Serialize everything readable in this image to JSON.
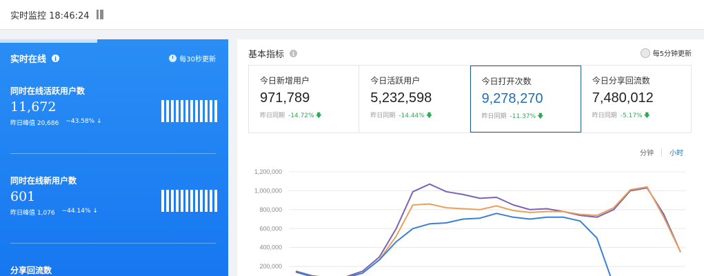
{
  "topbar": {
    "title": "实时监控 18:46:24",
    "icon": "document-icon"
  },
  "left": {
    "header": "实时在线",
    "refresh": "每30秒更新",
    "metrics": [
      {
        "label": "同时在线活跃用户数",
        "value": "11,672",
        "peak": "昨日峰值 20,686",
        "change": "−43.58%",
        "arrow": "↓"
      },
      {
        "label": "同时在线新用户数",
        "value": "601",
        "peak": "昨日峰值 1,076",
        "change": "−44.14%",
        "arrow": "↓"
      },
      {
        "label": "分享回流数"
      }
    ]
  },
  "right": {
    "header": "基本指标",
    "refresh": "每5分钟更新",
    "cards": [
      {
        "label": "今日新增用户",
        "value": "971,789",
        "compare": "昨日同期",
        "pct": "-14.72%",
        "arrow": "🡇"
      },
      {
        "label": "今日活跃用户",
        "value": "5,232,598",
        "compare": "昨日同期",
        "pct": "-14.44%",
        "arrow": "🡇"
      },
      {
        "label": "今日打开次数",
        "value": "9,278,270",
        "compare": "昨日同期",
        "pct": "-11.37%",
        "arrow": "🡇"
      },
      {
        "label": "今日分享回流数",
        "value": "7,480,012",
        "compare": "昨日同期",
        "pct": "-5.17%",
        "arrow": "🡇"
      }
    ],
    "tabs": {
      "minute": "分钟",
      "hour": "小时"
    }
  },
  "chart_data": {
    "type": "line",
    "ylim": [
      0,
      1200000
    ],
    "yticks": [
      "1,200,000",
      "1,000,000",
      "800,000",
      "600,000",
      "400,000",
      "200,000"
    ],
    "yvalues": [
      1200000,
      1000000,
      800000,
      600000,
      400000,
      200000
    ],
    "x": [
      0,
      1,
      2,
      3,
      4,
      5,
      6,
      7,
      8,
      9,
      10,
      11,
      12,
      13,
      14,
      15,
      16,
      17,
      18,
      19,
      20,
      21,
      22,
      23
    ],
    "grid": true,
    "series": [
      {
        "color": "#7b62b8",
        "values": [
          150000,
          100000,
          80000,
          90000,
          150000,
          300000,
          600000,
          990000,
          1070000,
          990000,
          960000,
          920000,
          930000,
          850000,
          800000,
          810000,
          780000,
          740000,
          720000,
          800000,
          1000000,
          1030000,
          750000,
          350000
        ]
      },
      {
        "color": "#e8a05a",
        "values": [
          140000,
          90000,
          70000,
          80000,
          130000,
          270000,
          520000,
          850000,
          860000,
          820000,
          810000,
          800000,
          840000,
          790000,
          770000,
          780000,
          780000,
          750000,
          740000,
          820000,
          1010000,
          1040000,
          720000,
          350000
        ]
      },
      {
        "color": "#3a7fd6",
        "values": [
          140000,
          90000,
          70000,
          80000,
          130000,
          270000,
          460000,
          600000,
          650000,
          660000,
          700000,
          710000,
          760000,
          720000,
          700000,
          720000,
          720000,
          680000,
          500000,
          0,
          null,
          null,
          null,
          null
        ]
      }
    ]
  }
}
